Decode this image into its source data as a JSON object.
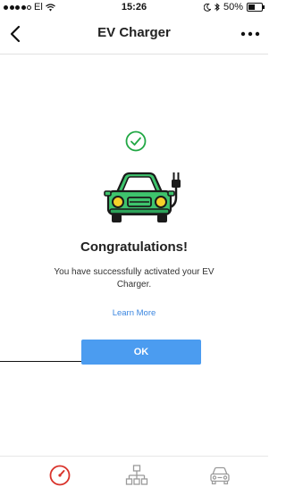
{
  "status_bar": {
    "carrier": "El",
    "time": "15:26",
    "battery_percent": "50%",
    "battery_level": 0.5
  },
  "nav": {
    "title": "EV Charger",
    "back_icon": "chevron-left-icon",
    "more_icon": "more-horizontal-icon"
  },
  "content": {
    "title": "Congratulations!",
    "message": "You have successfully activated your EV Charger.",
    "learn_more": "Learn More",
    "ok_label": "OK"
  },
  "tabs": [
    {
      "icon": "speedometer-icon",
      "active": true
    },
    {
      "icon": "network-icon",
      "active": false
    },
    {
      "icon": "car-icon",
      "active": false
    }
  ],
  "colors": {
    "accent": "#4b9cf0",
    "link": "#3b86e0",
    "success_green": "#22a845",
    "car_green": "#3ec46d",
    "headlight_yellow": "#f5d02a",
    "active_tab": "#d9332b",
    "inactive_tab": "#9a9a9a"
  }
}
